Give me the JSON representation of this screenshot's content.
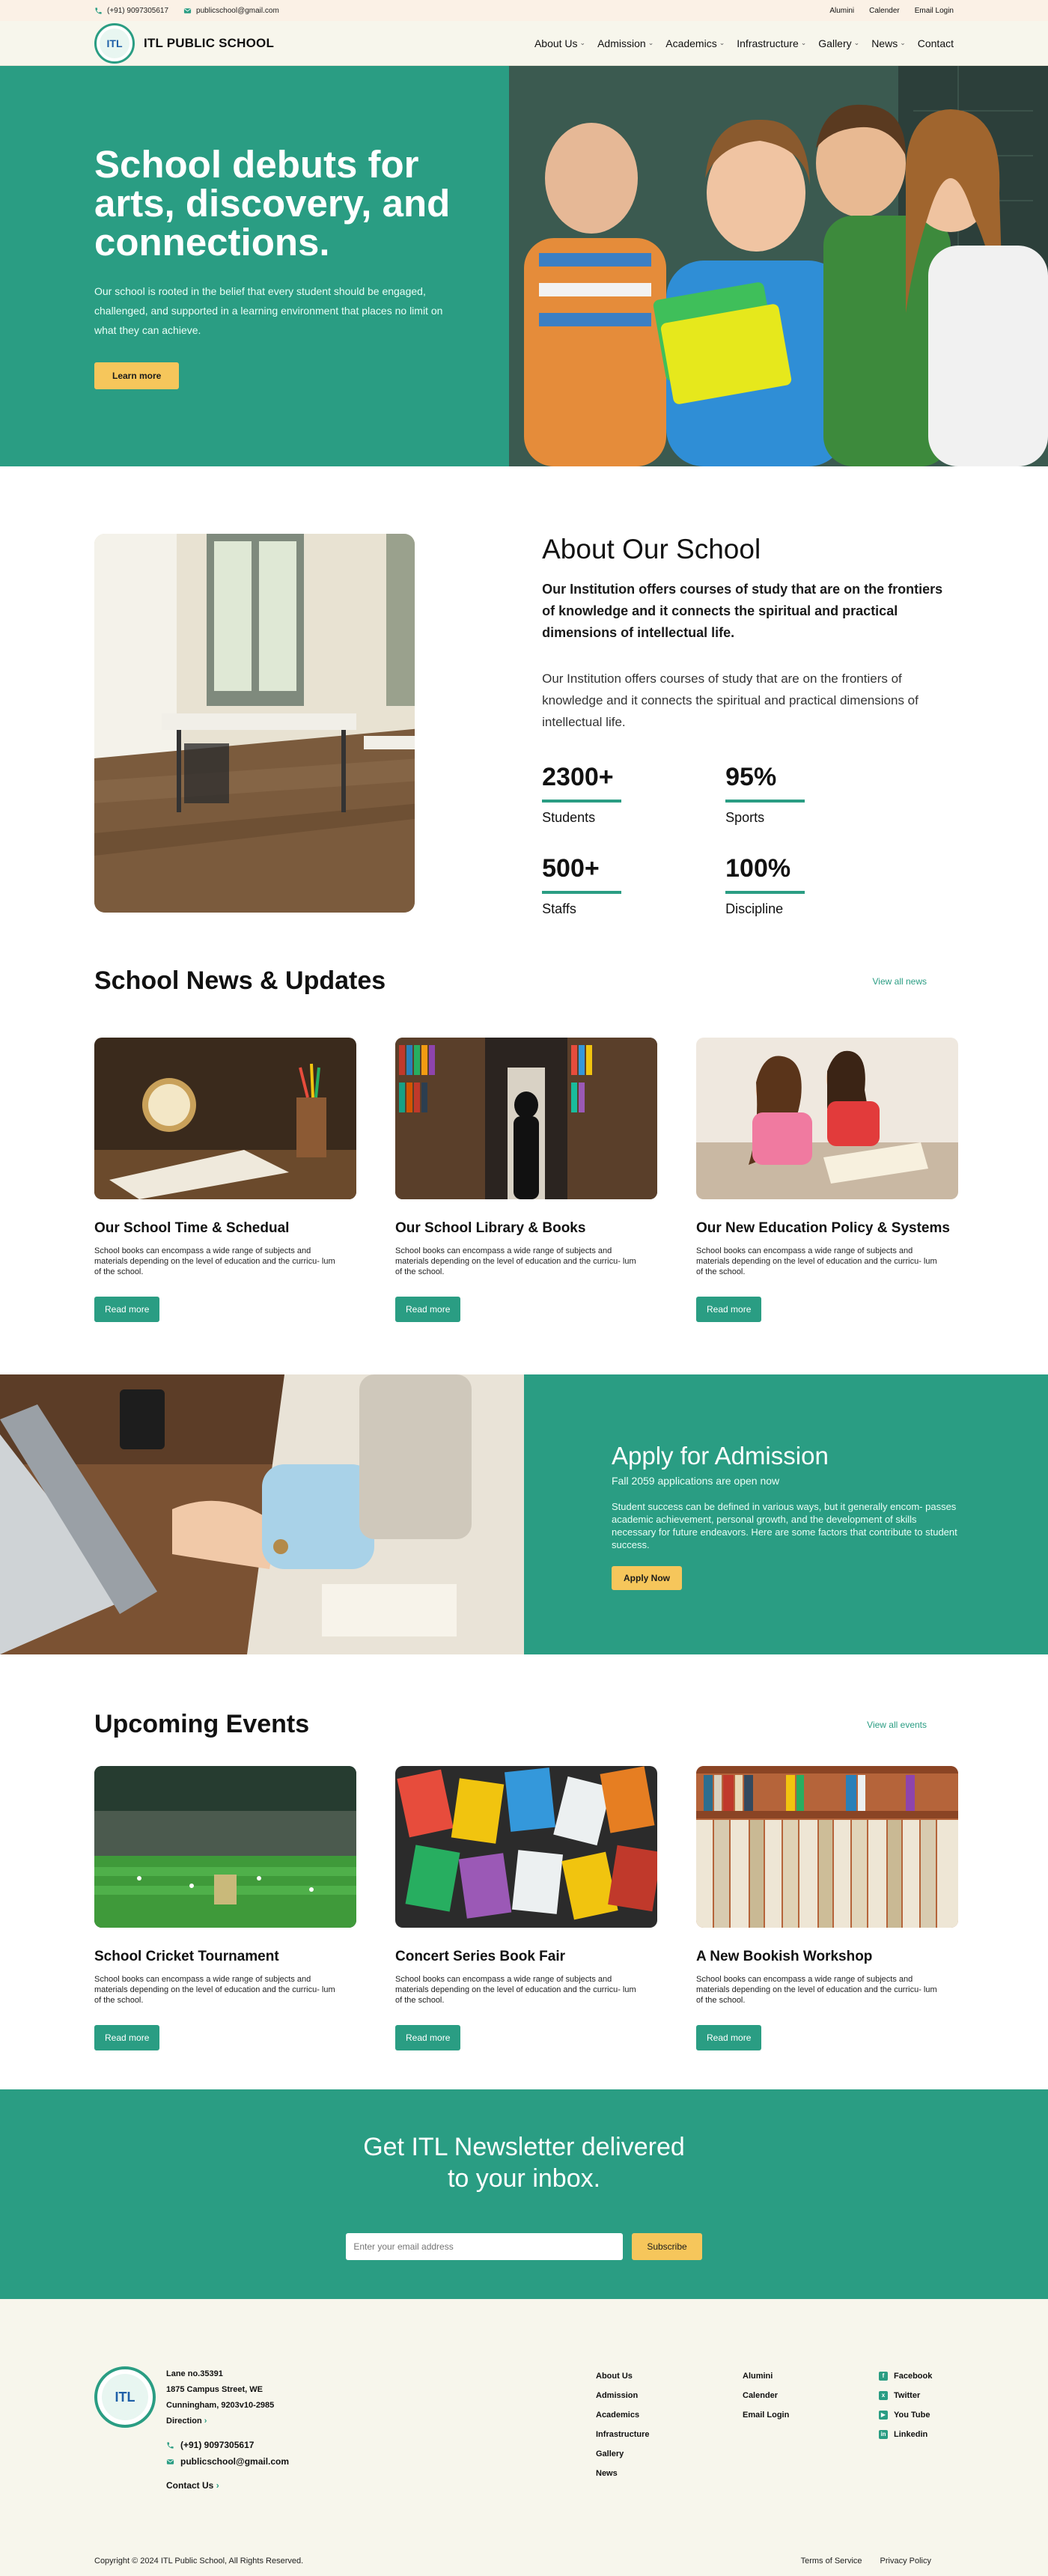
{
  "topbar": {
    "phone": "(+91) 9097305617",
    "email": "publicschool@gmail.com",
    "links": [
      "Alumini",
      "Calender",
      "Email Login"
    ]
  },
  "brand": {
    "name": "ITL PUBLIC SCHOOL",
    "logo_text": "ITL"
  },
  "nav": [
    {
      "label": "About Us",
      "dropdown": true
    },
    {
      "label": "Admission",
      "dropdown": true
    },
    {
      "label": "Academics",
      "dropdown": true
    },
    {
      "label": "Infrastructure",
      "dropdown": true
    },
    {
      "label": "Gallery",
      "dropdown": true
    },
    {
      "label": "News",
      "dropdown": true
    },
    {
      "label": "Contact",
      "dropdown": false
    }
  ],
  "hero": {
    "title": "School debuts for arts, discovery, and connections.",
    "text": "Our school is rooted in the belief that every student should be engaged, challenged, and supported in a learning environment that places no limit on what they can achieve.",
    "button": "Learn more"
  },
  "about": {
    "title": "About Our School",
    "lead": "Our Institution offers courses of study that are on the frontiers of knowledge and it connects the spiritual and practical dimensions of intellectual life.",
    "body": "Our Institution offers courses of study that are on the frontiers of knowledge and it connects the spiritual and practical dimensions of intellectual life.",
    "stats": [
      {
        "num": "2300+",
        "label": "Students"
      },
      {
        "num": "95%",
        "label": "Sports"
      },
      {
        "num": "500+",
        "label": "Staffs"
      },
      {
        "num": "100%",
        "label": "Discipline"
      }
    ]
  },
  "news": {
    "title": "School News & Updates",
    "view_all": "View all news",
    "cards": [
      {
        "title": "Our School Time & Schedual",
        "text": "School books can encompass a wide range of subjects and materials depending on the level of education and the curricu- lum of the school.",
        "button": "Read more"
      },
      {
        "title": "Our School Library & Books",
        "text": "School books can encompass a wide range of subjects and materials depending on the level of education and the curricu- lum of the school.",
        "button": "Read more"
      },
      {
        "title": "Our New Education Policy & Systems",
        "text": "School books can encompass a wide range of subjects and materials depending on the level of education and the curricu- lum of the school.",
        "button": "Read more"
      }
    ]
  },
  "admission": {
    "title": "Apply for Admission",
    "sub": "Fall 2059 applications are open now",
    "desc": "Student success can be defined in various ways, but it generally encom- passes academic achievement, personal growth, and the development of skills necessary for future endeavors. Here are some factors that contribute to student success.",
    "button": "Apply Now"
  },
  "events": {
    "title": "Upcoming Events",
    "view_all": "View all events",
    "cards": [
      {
        "title": "School Cricket Tournament",
        "text": "School books can encompass a wide range of subjects and materials depending on the level of education and the curricu- lum of the school.",
        "button": "Read more"
      },
      {
        "title": "Concert Series Book Fair",
        "text": "School books can encompass a wide range of subjects and materials depending on the level of education and the curricu- lum of the school.",
        "button": "Read more"
      },
      {
        "title": "A New Bookish Workshop",
        "text": "School books can encompass a wide range of subjects and materials depending on the level of education and the curricu- lum of the school.",
        "button": "Read more"
      }
    ]
  },
  "newsletter": {
    "title_line1": "Get ITL Newsletter delivered",
    "title_line2": "to your inbox.",
    "placeholder": "Enter your email address",
    "button": "Subscribe"
  },
  "footer": {
    "address": [
      "Lane no.35391",
      "1875 Campus Street, WE",
      "Cunningham, 9203v10-2985"
    ],
    "direction": "Direction",
    "phone": "(+91) 9097305617",
    "email": "publicschool@gmail.com",
    "contact": "Contact Us",
    "links1": [
      "About Us",
      "Admission",
      "Academics",
      "Infrastructure",
      "Gallery",
      "News"
    ],
    "links2": [
      "Alumini",
      "Calender",
      "Email Login"
    ],
    "social": [
      "Facebook",
      "Twitter",
      "You Tube",
      "Linkedin"
    ],
    "copyright": "Copyright © 2024 ITL Public School, All Rights Reserved.",
    "terms": "Terms of Service",
    "privacy": "Privacy Policy"
  },
  "colors": {
    "primary": "#2a9d83",
    "accent": "#f6c65b",
    "cream": "#f7f6ec"
  }
}
